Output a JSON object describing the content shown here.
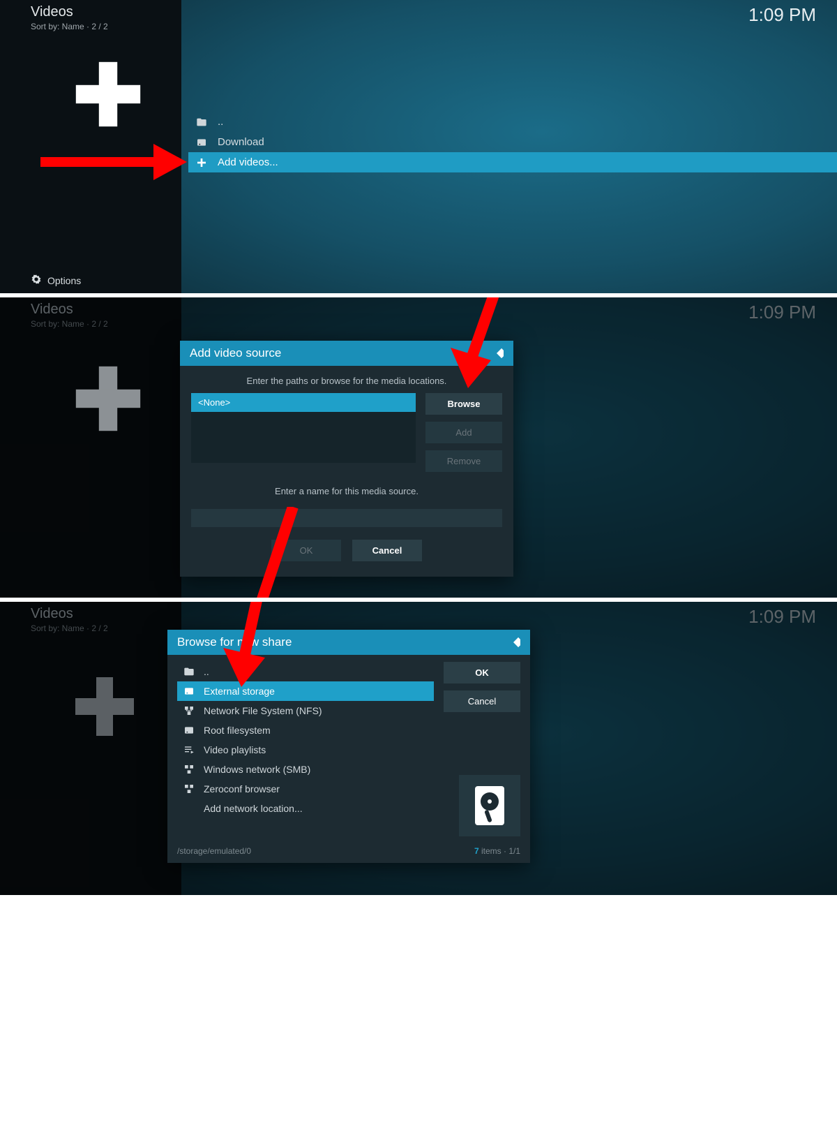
{
  "common": {
    "title": "Videos",
    "sort": "Sort by: Name  ·  2 / 2",
    "clock": "1:09 PM",
    "options": "Options"
  },
  "panel1": {
    "rows": {
      "up": "..",
      "download": "Download",
      "add": "Add videos..."
    }
  },
  "panel2": {
    "dialog_title": "Add video source",
    "instr": "Enter the paths or browse for the media locations.",
    "none": "<None>",
    "browse": "Browse",
    "add": "Add",
    "remove": "Remove",
    "name_instr": "Enter a name for this media source.",
    "ok": "OK",
    "cancel": "Cancel"
  },
  "panel3": {
    "dialog_title": "Browse for new share",
    "ok": "OK",
    "cancel": "Cancel",
    "rows": {
      "up": "..",
      "ext": "External storage",
      "nfs": "Network File System (NFS)",
      "root": "Root filesystem",
      "vpl": "Video playlists",
      "smb": "Windows network (SMB)",
      "zc": "Zeroconf browser",
      "addnet": "Add network location..."
    },
    "path": "/storage/emulated/0",
    "count_n": "7",
    "count_lbl": " items · ",
    "count_page": "1/1"
  }
}
